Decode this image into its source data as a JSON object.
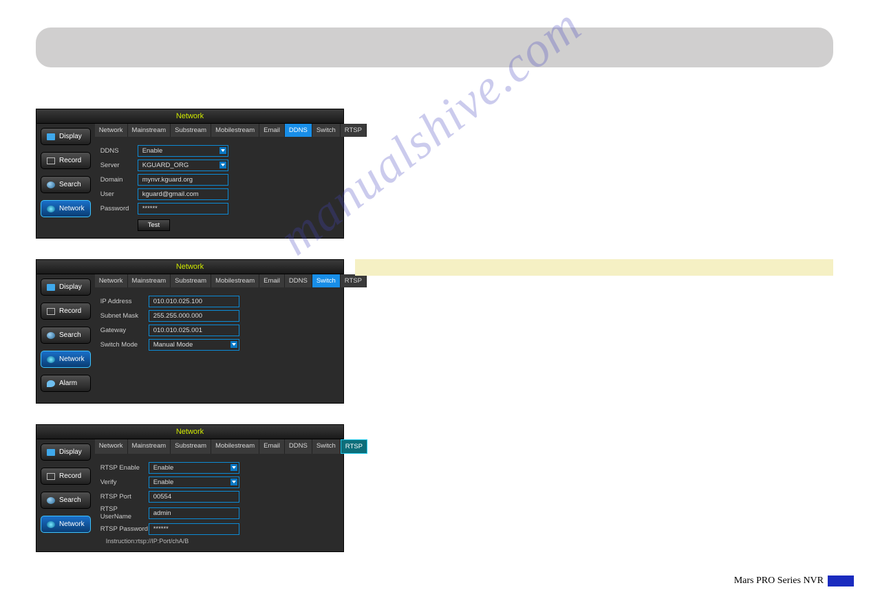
{
  "watermark": "manualshive.com",
  "footer": {
    "text": "Mars PRO Series NVR"
  },
  "section1": {
    "title": "Network",
    "sidebar": [
      {
        "label": "Display"
      },
      {
        "label": "Record"
      },
      {
        "label": "Search"
      },
      {
        "label": "Network"
      }
    ],
    "tabs": [
      "Network",
      "Mainstream",
      "Substream",
      "Mobilestream",
      "Email",
      "DDNS",
      "Switch",
      "RTSP"
    ],
    "active_tab": "DDNS",
    "fields": {
      "ddns_label": "DDNS",
      "ddns_value": "Enable",
      "server_label": "Server",
      "server_value": "KGUARD_ORG",
      "domain_label": "Domain",
      "domain_value": "mynvr.kguard.org",
      "user_label": "User",
      "user_value": "kguard@gmail.com",
      "password_label": "Password",
      "password_value": "******",
      "test_label": "Test"
    }
  },
  "section2": {
    "title": "Network",
    "sidebar": [
      {
        "label": "Display"
      },
      {
        "label": "Record"
      },
      {
        "label": "Search"
      },
      {
        "label": "Network"
      },
      {
        "label": "Alarm"
      }
    ],
    "tabs": [
      "Network",
      "Mainstream",
      "Substream",
      "Mobilestream",
      "Email",
      "DDNS",
      "Switch",
      "RTSP"
    ],
    "active_tab": "Switch",
    "fields": {
      "ip_label": "IP Address",
      "ip_value": "010.010.025.100",
      "mask_label": "Subnet Mask",
      "mask_value": "255.255.000.000",
      "gw_label": "Gateway",
      "gw_value": "010.010.025.001",
      "mode_label": "Switch Mode",
      "mode_value": "Manual Mode"
    }
  },
  "section3": {
    "title": "Network",
    "sidebar": [
      {
        "label": "Display"
      },
      {
        "label": "Record"
      },
      {
        "label": "Search"
      },
      {
        "label": "Network"
      }
    ],
    "tabs": [
      "Network",
      "Mainstream",
      "Substream",
      "Mobilestream",
      "Email",
      "DDNS",
      "Switch",
      "RTSP"
    ],
    "active_tab": "RTSP",
    "fields": {
      "enable_label": "RTSP Enable",
      "enable_value": "Enable",
      "verify_label": "Verify",
      "verify_value": "Enable",
      "port_label": "RTSP Port",
      "port_value": "00554",
      "uname_label": "RTSP UserName",
      "uname_value": "admin",
      "pwd_label": "RTSP Password",
      "pwd_value": "******",
      "instruction": "Instruction:rtsp://IP:Port/chA/B"
    }
  }
}
